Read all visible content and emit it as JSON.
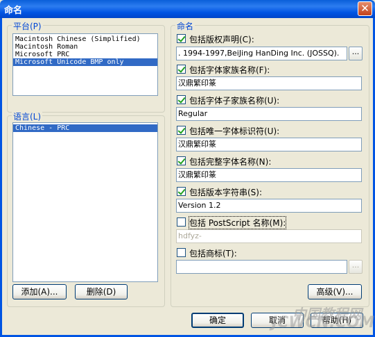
{
  "window": {
    "title": "命名",
    "close_glyph": "✕"
  },
  "platform": {
    "legend": "平台(P)",
    "items": [
      {
        "label": "Macintosh Chinese (Simplified)",
        "selected": false
      },
      {
        "label": "Macintosh Roman",
        "selected": false
      },
      {
        "label": "Microsoft PRC",
        "selected": false
      },
      {
        "label": "Microsoft Unicode BMP only",
        "selected": true
      }
    ]
  },
  "language": {
    "legend": "语言(L)",
    "items": [
      {
        "label": "Chinese - PRC",
        "selected": true
      }
    ]
  },
  "buttons": {
    "add": "添加(A)...",
    "delete": "删除(D)",
    "advanced": "高级(V)...",
    "ok": "确定",
    "cancel": "取消",
    "help": "帮助(H)"
  },
  "naming": {
    "legend": "命名",
    "copyright": {
      "label": "包括版权声明(C):",
      "checked": true,
      "value": ". 1994-1997,BeiJing HanDing Inc. (JOSSQ).",
      "browse": "..."
    },
    "family": {
      "label": "包括字体家族名称(F):",
      "checked": true,
      "value": "汉鼎繁印篆"
    },
    "subfamily": {
      "label": "包括字体子家族名称(U):",
      "checked": true,
      "value": "Regular"
    },
    "unique_id": {
      "label": "包括唯一字体标识符(U):",
      "checked": true,
      "value": "汉鼎繁印篆"
    },
    "full_name": {
      "label": "包括完整字体名称(N):",
      "checked": true,
      "value": "汉鼎繁印篆"
    },
    "version": {
      "label": "包括版本字符串(S):",
      "checked": true,
      "value": "Version 1.2"
    },
    "postscript": {
      "label": "包括 PostScript 名称(M):",
      "checked": false,
      "value": "hdfyz-"
    },
    "trademark": {
      "label": "包括商标(T):",
      "checked": false,
      "value": "",
      "browse": "..."
    }
  },
  "watermark": {
    "text": "中国教程网",
    "sub": "JCWCN.COM"
  }
}
